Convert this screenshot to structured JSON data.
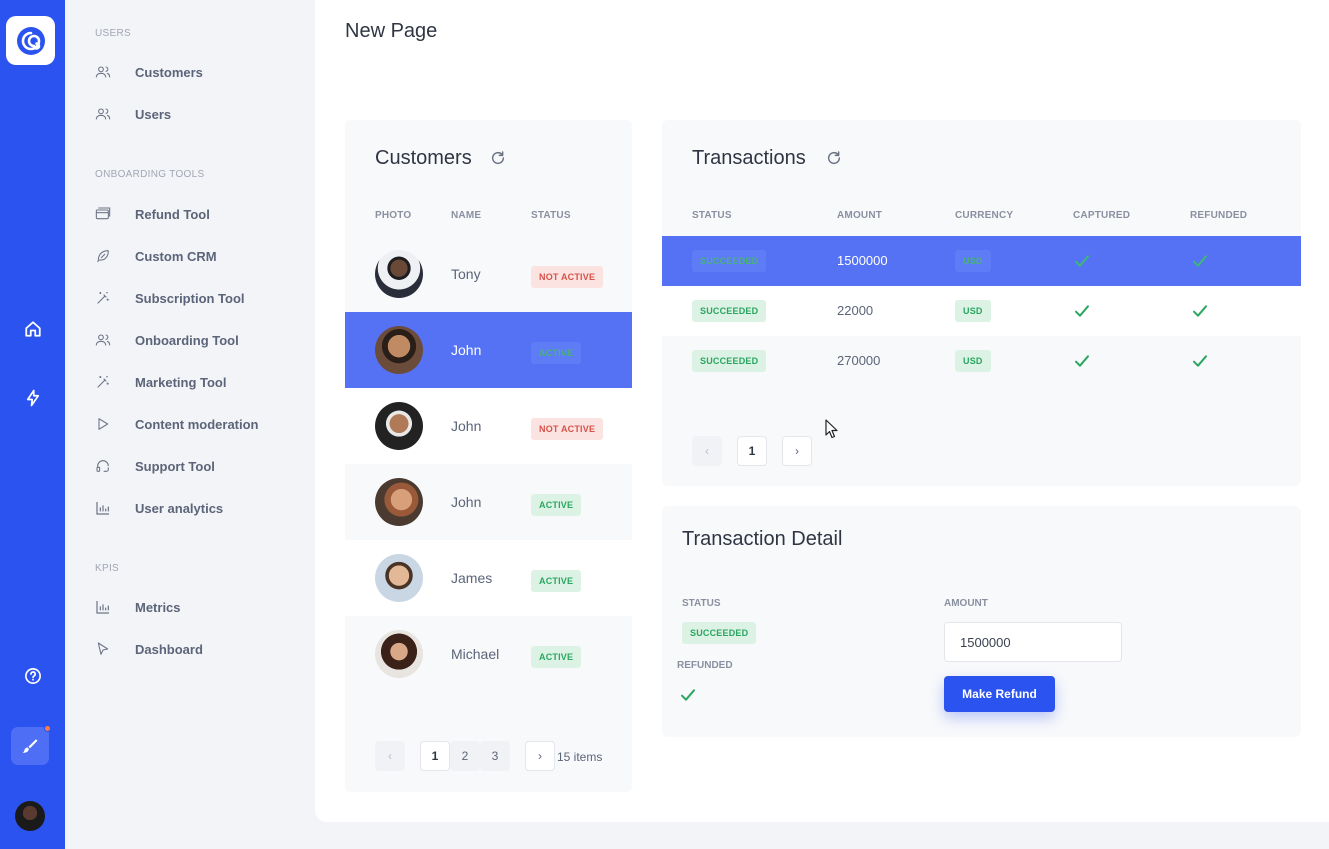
{
  "sidebar": {
    "sections": [
      {
        "title": "USERS",
        "items": [
          {
            "label": "Customers",
            "icon": "users-icon"
          },
          {
            "label": "Users",
            "icon": "users-icon"
          }
        ]
      },
      {
        "title": "ONBOARDING TOOLS",
        "items": [
          {
            "label": "Refund Tool",
            "icon": "card-icon"
          },
          {
            "label": "Custom CRM",
            "icon": "feather-icon"
          },
          {
            "label": "Subscription Tool",
            "icon": "wand-icon"
          },
          {
            "label": "Onboarding Tool",
            "icon": "users-icon"
          },
          {
            "label": "Marketing Tool",
            "icon": "wand-icon"
          },
          {
            "label": "Content moderation",
            "icon": "play-icon"
          },
          {
            "label": "Support Tool",
            "icon": "headset-icon"
          },
          {
            "label": "User analytics",
            "icon": "bar-chart-icon"
          }
        ]
      },
      {
        "title": "KPIS",
        "items": [
          {
            "label": "Metrics",
            "icon": "bar-chart-icon"
          },
          {
            "label": "Dashboard",
            "icon": "cursor-icon"
          }
        ]
      }
    ]
  },
  "page": {
    "title": "New Page"
  },
  "customers": {
    "title": "Customers",
    "columns": {
      "photo": "PHOTO",
      "name": "NAME",
      "status": "STATUS"
    },
    "rows": [
      {
        "name": "Tony",
        "status": "NOT ACTIVE"
      },
      {
        "name": "John",
        "status": "ACTIVE"
      },
      {
        "name": "John",
        "status": "NOT ACTIVE"
      },
      {
        "name": "John",
        "status": "ACTIVE"
      },
      {
        "name": "James",
        "status": "ACTIVE"
      },
      {
        "name": "Michael",
        "status": "ACTIVE"
      }
    ],
    "pager": {
      "prev": "‹",
      "pages": [
        "1",
        "2",
        "3"
      ],
      "next": "›",
      "count": "15 items"
    }
  },
  "transactions": {
    "title": "Transactions",
    "columns": {
      "status": "STATUS",
      "amount": "AMOUNT",
      "currency": "CURRENCY",
      "captured": "CAPTURED",
      "refunded": "REFUNDED"
    },
    "rows": [
      {
        "status": "SUCCEEDED",
        "amount": "1500000",
        "currency": "USD"
      },
      {
        "status": "SUCCEEDED",
        "amount": "22000",
        "currency": "USD"
      },
      {
        "status": "SUCCEEDED",
        "amount": "270000",
        "currency": "USD"
      }
    ],
    "pager": {
      "prev": "‹",
      "page": "1",
      "next": "›"
    }
  },
  "detail": {
    "title": "Transaction Detail",
    "status_label": "STATUS",
    "status_value": "SUCCEEDED",
    "refunded_label": "REFUNDED",
    "amount_label": "AMOUNT",
    "amount_value": "1500000",
    "refund_button": "Make Refund"
  },
  "colors": {
    "primary": "#2b53f0",
    "selected_row": "#5472f3",
    "success": "#2aa660",
    "danger": "#d6524a"
  }
}
